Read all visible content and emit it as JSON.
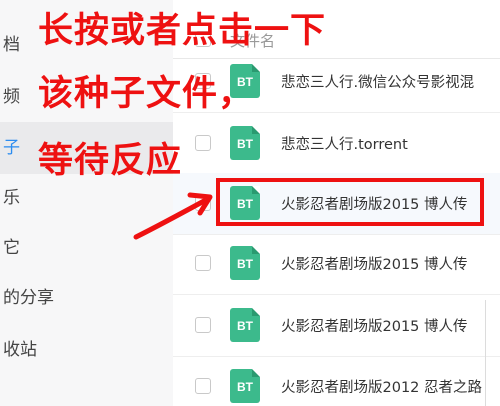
{
  "sidebar": {
    "items": [
      {
        "label": "档"
      },
      {
        "label": "频"
      },
      {
        "label": "子"
      },
      {
        "label": "乐"
      },
      {
        "label": "它"
      },
      {
        "label": "的分享"
      },
      {
        "label": "收站"
      }
    ]
  },
  "file_list": {
    "header_label": "文件名",
    "files": [
      {
        "icon": "BT",
        "name": "悲恋三人行.微信公众号影视混"
      },
      {
        "icon": "BT",
        "name": "悲恋三人行.torrent"
      },
      {
        "icon": "BT",
        "name": "火影忍者剧场版2015 博人传"
      },
      {
        "icon": "BT",
        "name": "火影忍者剧场版2015 博人传"
      },
      {
        "icon": "BT",
        "name": "火影忍者剧场版2015 博人传"
      },
      {
        "icon": "BT",
        "name": "火影忍者剧场版2012 忍者之路"
      }
    ]
  },
  "annotation": {
    "line1": "长按或者点击一下",
    "line2": "该种子文件，",
    "line3": "等待反应",
    "color": "#ee1111"
  },
  "colors": {
    "bt_icon": "#3cba8c",
    "sidebar_active_text": "#2b8cf0"
  }
}
